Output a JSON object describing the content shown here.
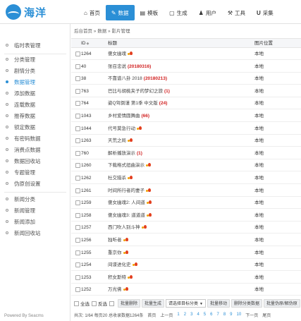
{
  "app": {
    "logo_text": "海洋"
  },
  "nav": [
    {
      "label": "首页",
      "icon": "home-icon",
      "glyph": "⌂"
    },
    {
      "label": "数据",
      "icon": "edit-icon",
      "glyph": "✎",
      "active": true
    },
    {
      "label": "模板",
      "icon": "template-icon",
      "glyph": "▤"
    },
    {
      "label": "生成",
      "icon": "file-icon",
      "glyph": "▢"
    },
    {
      "label": "用户",
      "icon": "user-icon",
      "glyph": "♟"
    },
    {
      "label": "工具",
      "icon": "wrench-icon",
      "glyph": "⚒"
    },
    {
      "label": "采集",
      "icon": "magnet-icon",
      "glyph": "U"
    }
  ],
  "sidebar": {
    "items": [
      {
        "label": "临时表管理"
      },
      {
        "label": "分类管理"
      },
      {
        "label": "剧情分类"
      },
      {
        "label": "数据管理",
        "active": true
      },
      {
        "label": "添加数据"
      },
      {
        "label": "连载数据"
      },
      {
        "label": "推荐数据"
      },
      {
        "label": "锁定数据"
      },
      {
        "label": "有密码数据"
      },
      {
        "label": "消费点数据"
      },
      {
        "label": "数据回收站"
      },
      {
        "label": "专题管理"
      },
      {
        "label": "伪原创设置"
      },
      {
        "label": "新闻分类"
      },
      {
        "label": "新闻管理"
      },
      {
        "label": "新闻添加"
      },
      {
        "label": "新闻回收站"
      }
    ],
    "powered": "Powered By Seacms"
  },
  "breadcrumb": "后台首页 » 数据 » 影片管理",
  "table": {
    "headers": {
      "id": "ID",
      "title": "标题",
      "position": "图片位置"
    },
    "rows": [
      {
        "id": "1264",
        "title": "傻女幽魂",
        "fire": true,
        "pos": "本地"
      },
      {
        "id": "40",
        "title": "张召忠说",
        "tag": "(20180316)",
        "pos": "本地"
      },
      {
        "id": "38",
        "title": "不靠谱八卦 2018",
        "tag": "(20180213)",
        "pos": "本地"
      },
      {
        "id": "763",
        "title": "巴比与胡桃夹子的梦幻之旅",
        "tag": "(1)",
        "pos": "本地"
      },
      {
        "id": "764",
        "title": "姿Q驾倒谨 第1季 中文版",
        "tag": "(24)",
        "pos": "本地"
      },
      {
        "id": "1043",
        "title": "乡村爱情圆舞曲",
        "tag": "(66)",
        "pos": "本地"
      },
      {
        "id": "1044",
        "title": "代号莫急行动",
        "fire": true,
        "pos": "本地"
      },
      {
        "id": "1263",
        "title": "天荒之局",
        "fire": true,
        "pos": "本地"
      },
      {
        "id": "760",
        "title": "解析播放演示",
        "tag": "(1)",
        "pos": "本地"
      },
      {
        "id": "1260",
        "title": "下载格式扭曲演示",
        "fire": true,
        "pos": "本地"
      },
      {
        "id": "1262",
        "title": "杜交猎杀",
        "fire": true,
        "pos": "本地"
      },
      {
        "id": "1261",
        "title": "时间所行者的妻子",
        "fire": true,
        "pos": "本地"
      },
      {
        "id": "1259",
        "title": "傻女幽魂2: 人间道",
        "fire": true,
        "pos": "本地"
      },
      {
        "id": "1258",
        "title": "傻女幽魂3: 道道道",
        "fire": true,
        "pos": "本地"
      },
      {
        "id": "1257",
        "title": "西门吹人别斗神",
        "fire": true,
        "pos": "本地"
      },
      {
        "id": "1256",
        "title": "独听者",
        "fire": true,
        "pos": "本地"
      },
      {
        "id": "1255",
        "title": "重京你",
        "fire": true,
        "pos": "本地"
      },
      {
        "id": "1254",
        "title": "间谍进化史",
        "fire": true,
        "pos": "本地"
      },
      {
        "id": "1253",
        "title": "积女斯特",
        "fire": true,
        "pos": "本地"
      },
      {
        "id": "1252",
        "title": "万光佛",
        "fire": true,
        "pos": "本地"
      }
    ]
  },
  "actions": {
    "select_all": "全选",
    "invert": "反选",
    "batch_delete": "批量删除",
    "batch_generate": "批量生成",
    "target_category": "请选择目标分类",
    "batch_move": "批量移动",
    "delete_category_data": "删除分类数据",
    "batch_pseudo": "批量伪原/解伪原"
  },
  "pager": {
    "info": "共次: 1/64 每页20 总收录数据1264条",
    "first": "首页",
    "prev": "上一页",
    "pages": [
      "1",
      "2",
      "3",
      "4",
      "5",
      "6",
      "7",
      "8",
      "9",
      "10"
    ],
    "next": "下一页",
    "last": "尾页"
  },
  "colors": {
    "accent": "#2b8fd6",
    "tag_red": "#d12020"
  }
}
